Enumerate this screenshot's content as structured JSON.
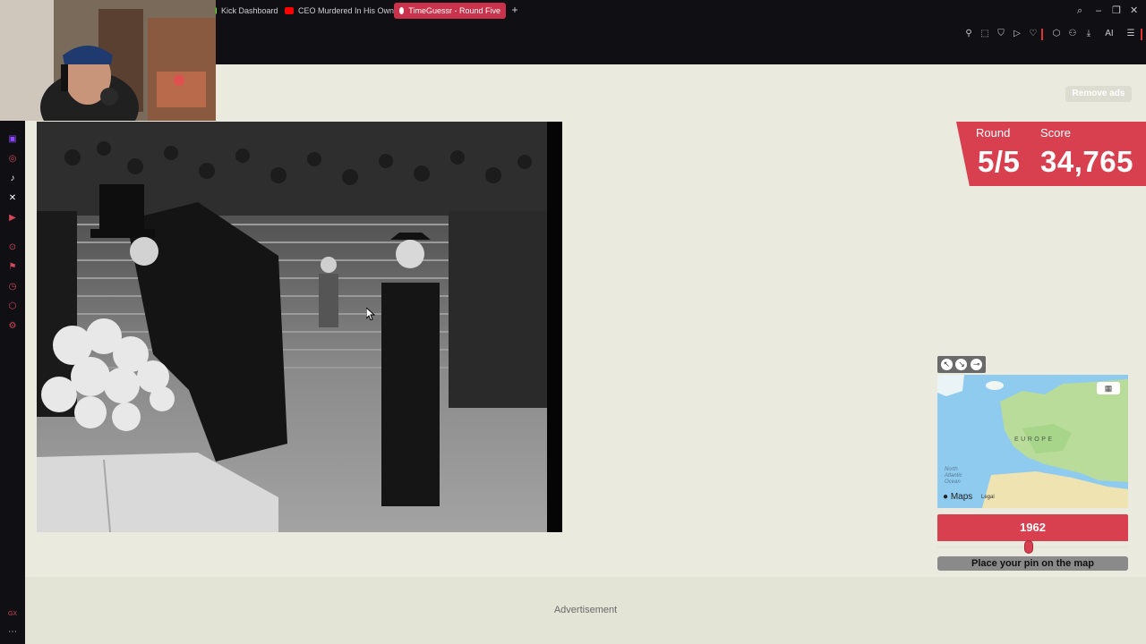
{
  "browser": {
    "tabs": [
      {
        "label": "Kick Dashboard",
        "active": false,
        "favicon_color": "#53fc18"
      },
      {
        "label": "CEO Murdered In His Own",
        "active": false,
        "favicon_color": "#ff0000"
      },
      {
        "label": "TimeGuessr - Round Five",
        "active": true,
        "favicon_color": "#ffffff"
      }
    ],
    "toolbar_right_label": "AI",
    "accent_color": "#d8404f"
  },
  "page": {
    "remove_ads_label": "Remove ads",
    "round": {
      "label": "Round",
      "value": "5/5"
    },
    "score": {
      "label": "Score",
      "value": "34,765"
    },
    "map": {
      "region_label": "EUROPE",
      "ocean_label": "North\nAtlantic\nOcean",
      "provider": "Maps",
      "legal": "Legal"
    },
    "year": {
      "value": "1962",
      "fraction": 0.48
    },
    "place_pin_label": "Place your pin on the map",
    "advertisement_label": "Advertisement"
  },
  "colors": {
    "brand_red": "#d8404f",
    "page_bg": "#eaeadf",
    "browser_bg": "#0f0f14"
  }
}
